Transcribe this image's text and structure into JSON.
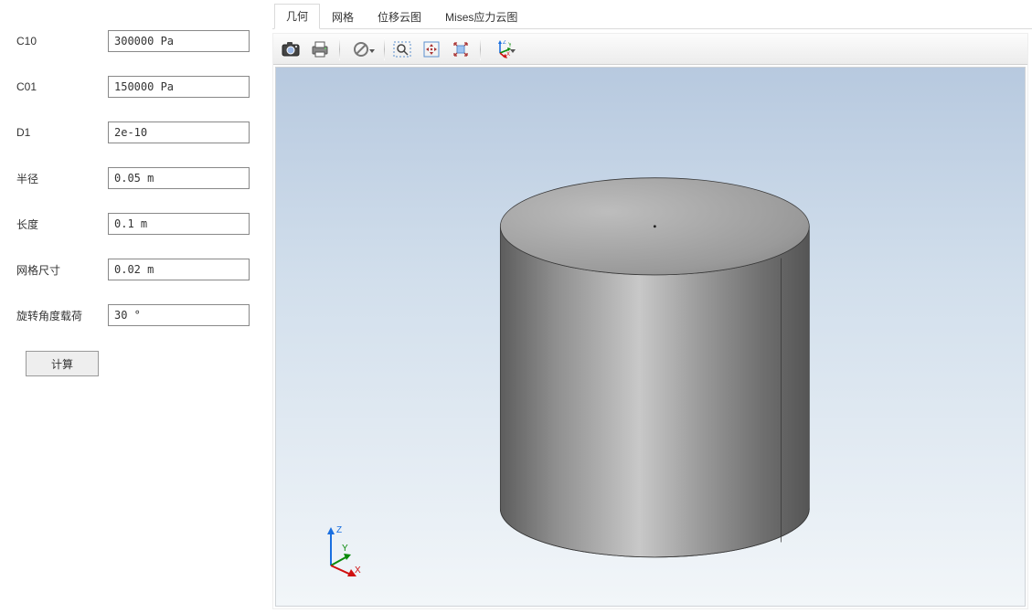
{
  "form": {
    "fields": [
      {
        "label": "C10",
        "value": "300000 Pa"
      },
      {
        "label": "C01",
        "value": "150000 Pa"
      },
      {
        "label": "D1",
        "value": "2e-10"
      },
      {
        "label": "半径",
        "value": "0.05 m"
      },
      {
        "label": "长度",
        "value": "0.1 m"
      },
      {
        "label": "网格尺寸",
        "value": "0.02 m"
      },
      {
        "label": "旋转角度载荷",
        "value": "30 °"
      }
    ],
    "compute_label": "计算"
  },
  "tabs": [
    {
      "label": "几何",
      "active": true
    },
    {
      "label": "网格",
      "active": false
    },
    {
      "label": "位移云图",
      "active": false
    },
    {
      "label": "Mises应力云图",
      "active": false
    }
  ],
  "toolbar": {
    "snapshot": "camera-icon",
    "print": "printer-icon",
    "cancel": "cancel-icon",
    "zoom_box": "zoom-box-icon",
    "pan": "pan-icon",
    "fit": "fit-view-icon",
    "axes": "axes-icon"
  },
  "triad": {
    "x": "X",
    "y": "Y",
    "z": "Z"
  }
}
